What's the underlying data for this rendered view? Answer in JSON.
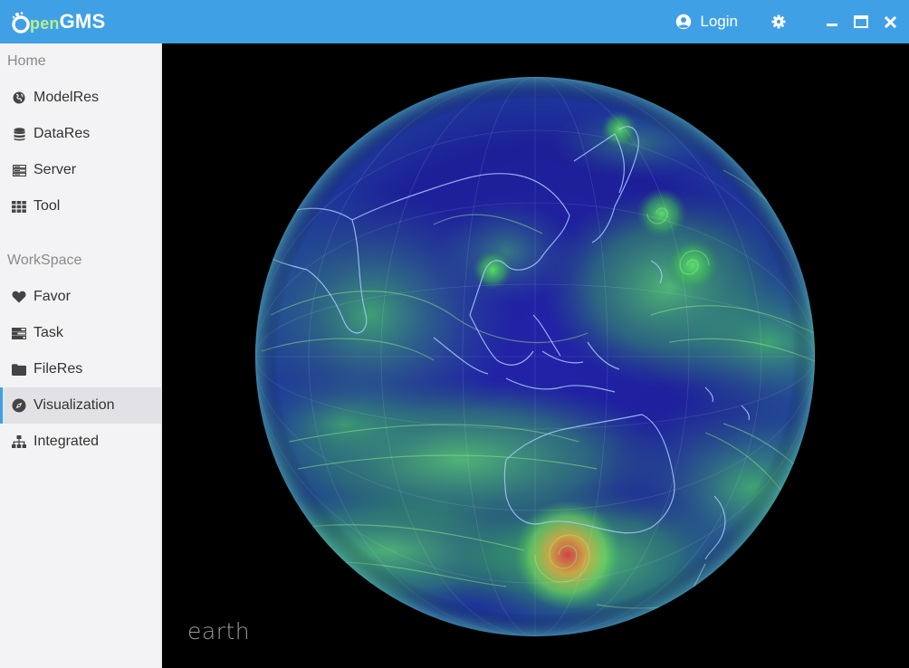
{
  "app": {
    "logo_o": "o",
    "logo_pen": "pen",
    "logo_gms": "GMS"
  },
  "header": {
    "login_label": "Login"
  },
  "sidebar": {
    "sections": [
      {
        "title": "Home"
      },
      {
        "title": "WorkSpace"
      }
    ],
    "home_items": [
      {
        "label": "ModelRes",
        "icon": "globe-icon"
      },
      {
        "label": "DataRes",
        "icon": "database-icon"
      },
      {
        "label": "Server",
        "icon": "server-icon"
      },
      {
        "label": "Tool",
        "icon": "grid-icon"
      }
    ],
    "workspace_items": [
      {
        "label": "Favor",
        "icon": "heart-icon"
      },
      {
        "label": "Task",
        "icon": "tasks-icon"
      },
      {
        "label": "FileRes",
        "icon": "folder-icon"
      },
      {
        "label": "Visualization",
        "icon": "compass-icon",
        "active": true
      },
      {
        "label": "Integrated",
        "icon": "sitemap-icon"
      }
    ]
  },
  "main": {
    "earth_label": "earth"
  },
  "colors": {
    "titlebar": "#3fa0e6",
    "sidebar_bg": "#f3f3f5",
    "active_bg": "#e2e2e6",
    "globe_ocean": "#1e1f9a",
    "globe_wind": "#39d65a",
    "coast": "#a8c8ff"
  }
}
